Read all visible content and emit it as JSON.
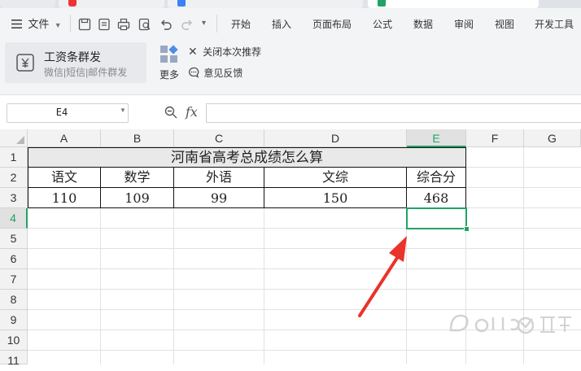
{
  "menu": {
    "file": "文件",
    "tabs": [
      "开始",
      "插入",
      "页面布局",
      "公式",
      "数据",
      "审阅",
      "视图",
      "开发工具"
    ]
  },
  "ribbon": {
    "feature_title": "工资条群发",
    "feature_subtitle": "微信|短信|邮件群发",
    "more_label": "更多",
    "close_recommend": "关闭本次推荐",
    "feedback": "意见反馈"
  },
  "formula_bar": {
    "cell_ref": "E4",
    "fx_label": "fx",
    "formula": ""
  },
  "sheet": {
    "columns": [
      "A",
      "B",
      "C",
      "D",
      "E",
      "F",
      "G"
    ],
    "rows": [
      "1",
      "2",
      "3",
      "4",
      "5",
      "6",
      "7",
      "8",
      "9",
      "10",
      "11"
    ],
    "title": "河南省高考总成绩怎么算",
    "headers": [
      "语文",
      "数学",
      "外语",
      "文综",
      "综合分"
    ],
    "values": [
      "110",
      "109",
      "99",
      "150",
      "468"
    ],
    "selected_cell": "E4"
  },
  "colors": {
    "accent_green": "#21a366",
    "annotation_arrow": "#e8342a",
    "header_bg": "#f2f2f2",
    "selected_header_bg": "#e1e1e1"
  }
}
